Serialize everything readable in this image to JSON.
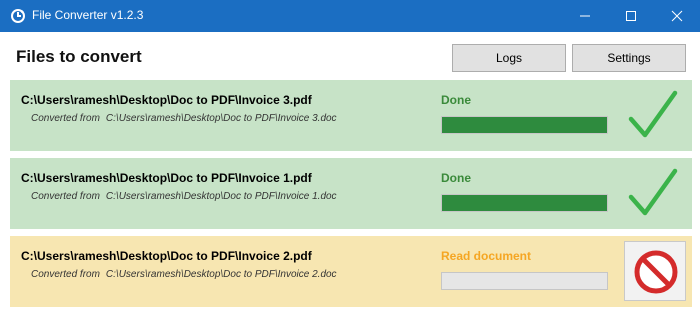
{
  "window": {
    "title": "File Converter v1.2.3",
    "icon": "file-converter-icon",
    "controls": [
      "minimize-icon",
      "maximize-icon",
      "close-icon"
    ]
  },
  "header": {
    "title": "Files to convert",
    "buttons": {
      "logs": "Logs",
      "settings": "Settings"
    }
  },
  "colors": {
    "titlebar": "#1b6ec2",
    "done_bg": "#c7e3c7",
    "pending_bg": "#f7e6b1",
    "done_text": "#3a8a3a",
    "reading_text": "#f5a623",
    "progress_fill": "#2e8b3e"
  },
  "files": [
    {
      "path": "C:\\Users\\ramesh\\Desktop\\Doc to PDF\\Invoice 3.pdf",
      "converted_label": "Converted from",
      "source": "C:\\Users\\ramesh\\Desktop\\Doc to PDF\\Invoice 3.doc",
      "status": "Done",
      "progress": 1.0,
      "state_icon": "checkmark-icon"
    },
    {
      "path": "C:\\Users\\ramesh\\Desktop\\Doc to PDF\\Invoice 1.pdf",
      "converted_label": "Converted from",
      "source": "C:\\Users\\ramesh\\Desktop\\Doc to PDF\\Invoice 1.doc",
      "status": "Done",
      "progress": 1.0,
      "state_icon": "checkmark-icon"
    },
    {
      "path": "C:\\Users\\ramesh\\Desktop\\Doc to PDF\\Invoice 2.pdf",
      "converted_label": "Converted from",
      "source": "C:\\Users\\ramesh\\Desktop\\Doc to PDF\\Invoice 2.doc",
      "status": "Read document",
      "progress": 0.0,
      "state_icon": "cancel-icon"
    }
  ]
}
